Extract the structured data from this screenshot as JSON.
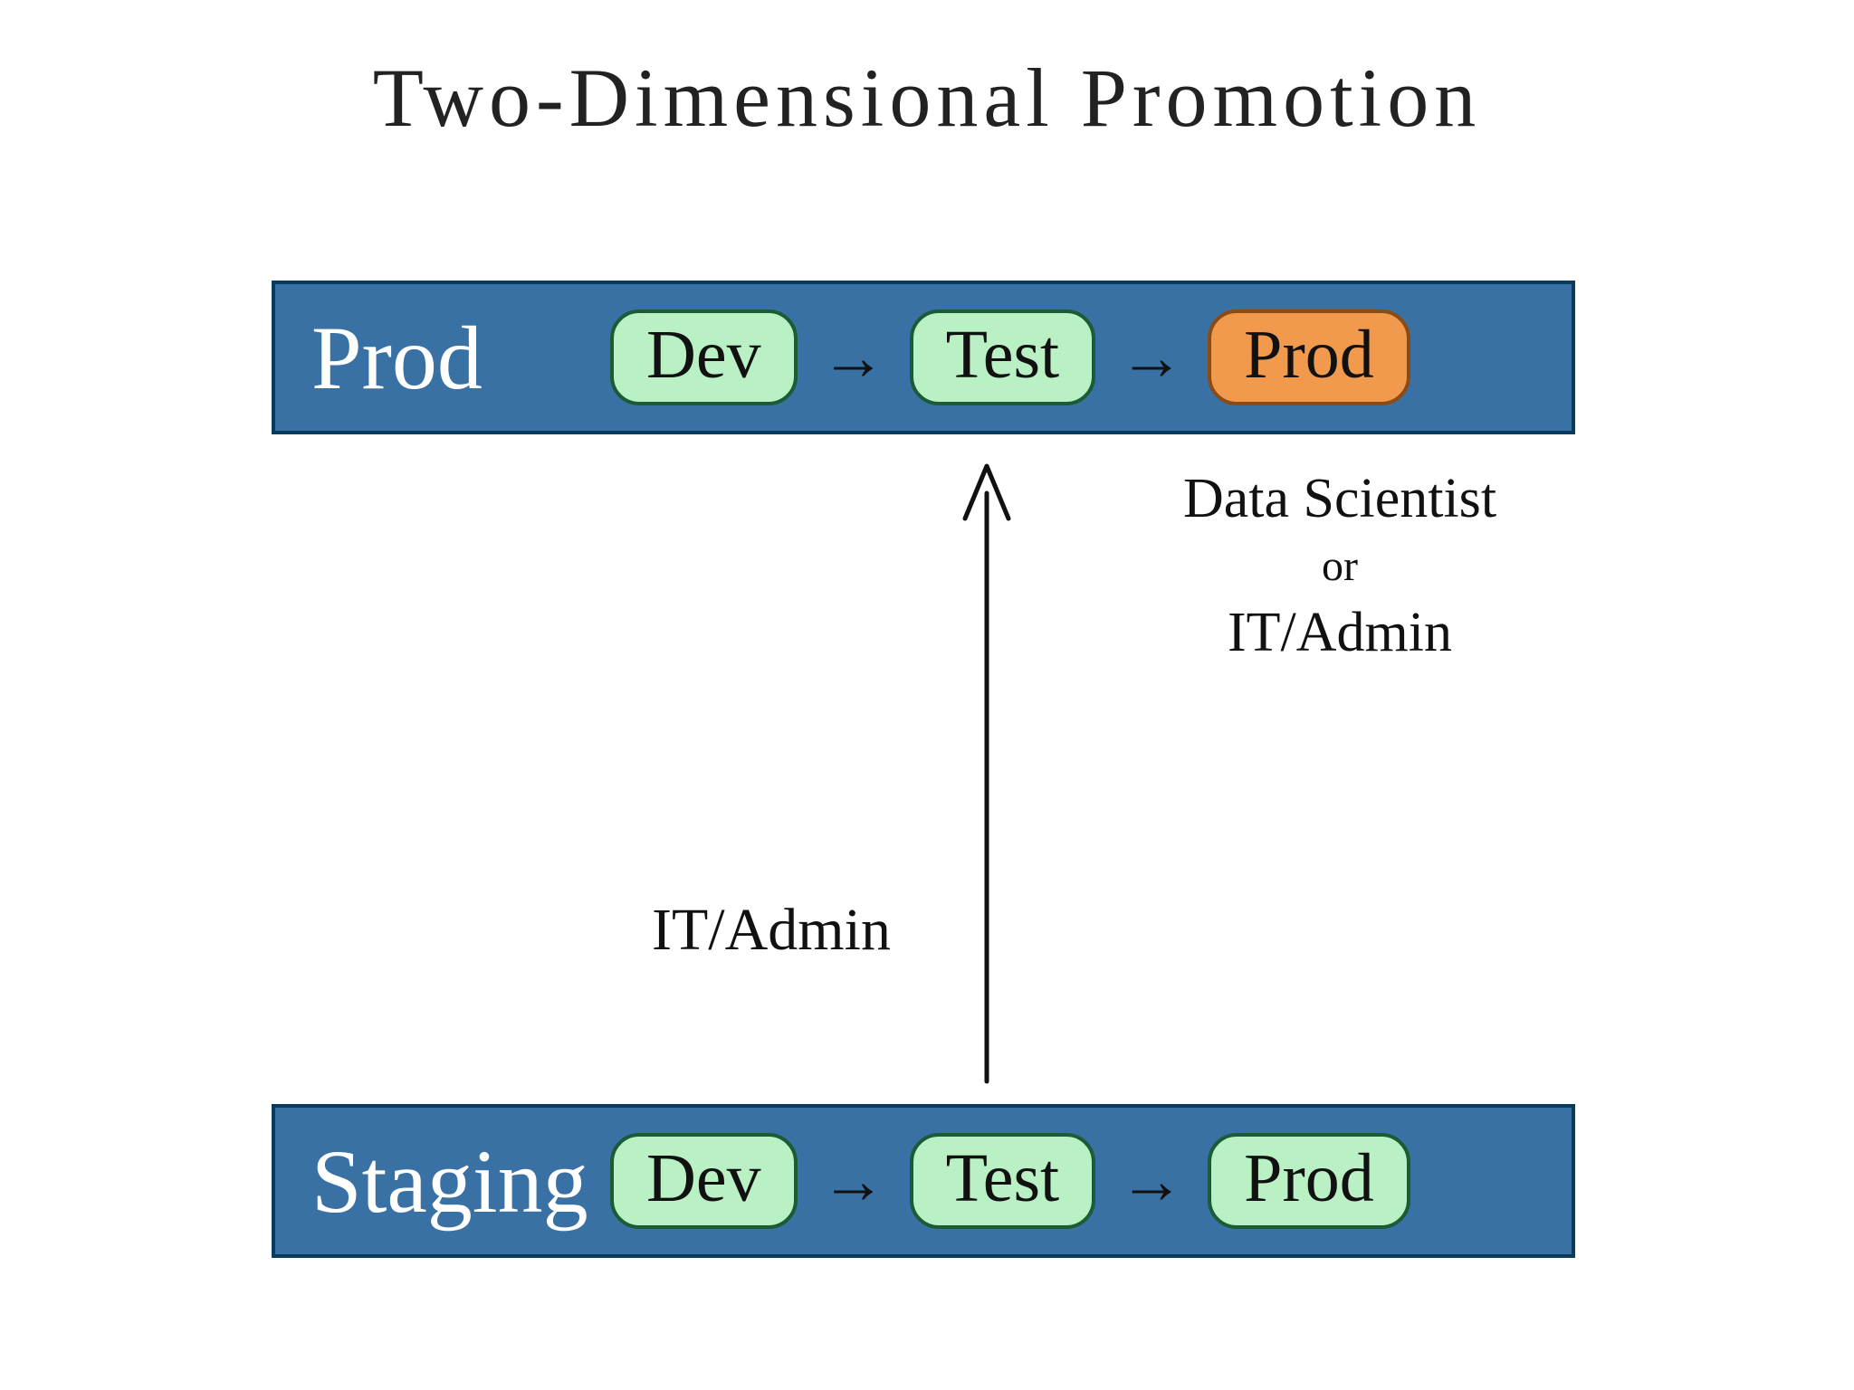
{
  "title": "Two-Dimensional Promotion",
  "environments": {
    "top": {
      "label": "Prod",
      "stages": [
        "Dev",
        "Test",
        "Prod"
      ],
      "highlight_last": true
    },
    "bottom": {
      "label": "Staging",
      "stages": [
        "Dev",
        "Test",
        "Prod"
      ],
      "highlight_last": false
    }
  },
  "vertical_arrow_label": "IT/Admin",
  "horizontal_role_label": {
    "line1": "Data Scientist",
    "line2": "or",
    "line3": "IT/Admin"
  },
  "colors": {
    "bar_bg": "#3a71a4",
    "bar_border": "#083b5e",
    "pill_green": "#b9f0c4",
    "pill_orange": "#f19a4e"
  }
}
